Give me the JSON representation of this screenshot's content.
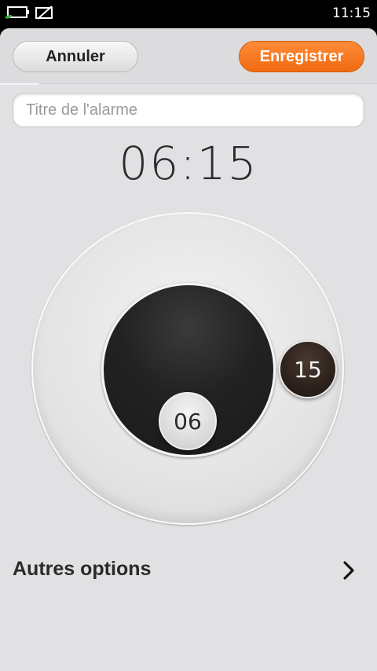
{
  "status_bar": {
    "time": "11:15",
    "icons": [
      "battery-charging-icon",
      "no-signal-icon"
    ]
  },
  "toolbar": {
    "cancel_label": "Annuler",
    "save_label": "Enregistrer"
  },
  "alarm": {
    "title_placeholder": "Titre de l'alarme",
    "title_value": "",
    "time": "06:15",
    "hour": "06",
    "minute": "15"
  },
  "options": {
    "more_label": "Autres options"
  },
  "colors": {
    "accent": "#f5781f",
    "background": "#e1e1e3"
  }
}
